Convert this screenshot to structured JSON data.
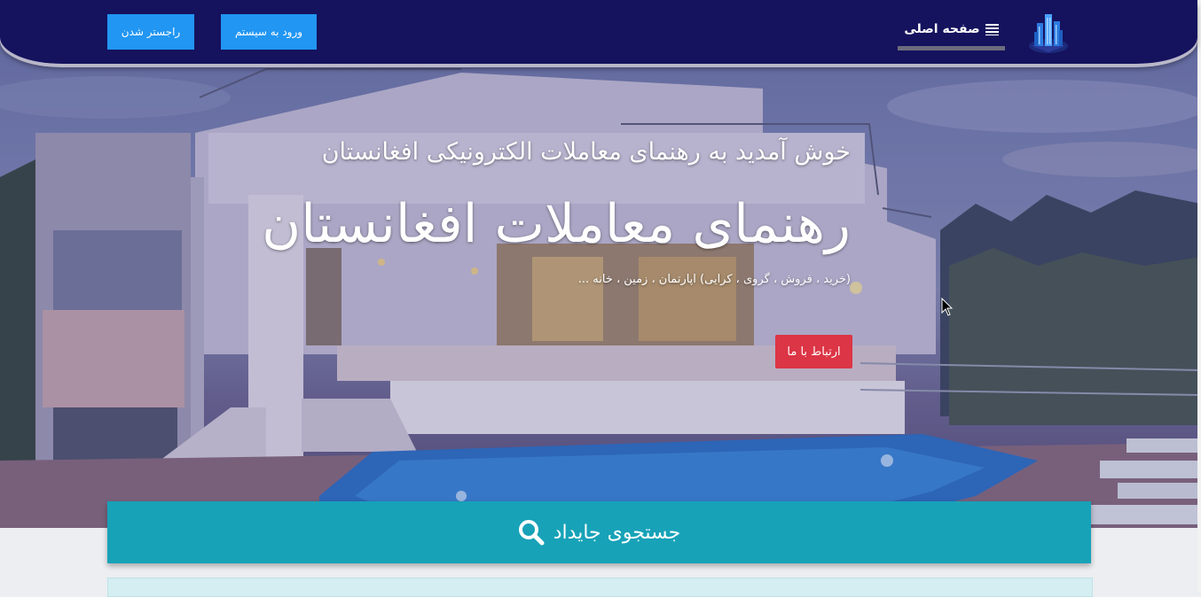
{
  "navbar": {
    "register_label": "راجستر شدن",
    "login_label": "ورود به سیستم",
    "home_label": "صفحه اصلی",
    "menu_icon": "menu-lines-icon",
    "logo_icon": "buildings-logo-icon",
    "background_color": "#15125e"
  },
  "hero": {
    "welcome": "خوش آمدید به رهنمای معاملات الکترونیکی افغانستان",
    "title": "رهنمای معاملات افغانستان",
    "subtitle": "(خرید ، فروش ، گروی ، کرایی) اپارتمان ، زمین ، خانه ...",
    "contact_label": "ارتباط با ما",
    "contact_color": "#dc3545"
  },
  "search": {
    "label": "جستجوی جایداد",
    "icon": "search-icon",
    "color": "#17a2b8"
  }
}
